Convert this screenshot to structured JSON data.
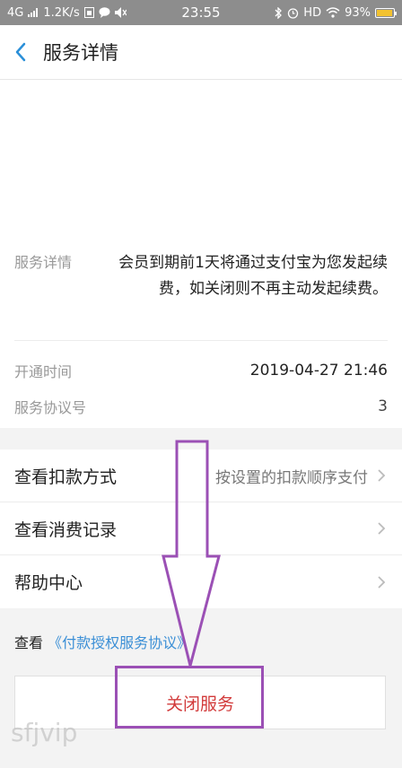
{
  "status_bar": {
    "network": "4G",
    "speed": "1.2K/s",
    "time": "23:55",
    "hd": "HD",
    "battery": "93%"
  },
  "header": {
    "title": "服务详情"
  },
  "details": {
    "service_detail_label": "服务详情",
    "service_detail_text": "会员到期前1天将通过支付宝为您发起续费，如关闭则不再主动发起续费。",
    "open_time_label": "开通时间",
    "open_time_value": "2019-04-27 21:46",
    "agreement_no_label": "服务协议号",
    "agreement_no_value": "3"
  },
  "menu": {
    "items": [
      {
        "label": "查看扣款方式",
        "value": "按设置的扣款顺序支付"
      },
      {
        "label": "查看消费记录",
        "value": ""
      },
      {
        "label": "帮助中心",
        "value": ""
      }
    ]
  },
  "agreement_link": {
    "prefix": "查看",
    "link": "《付款授权服务协议》"
  },
  "close_button": {
    "label": "关闭服务"
  },
  "watermark": "sfjvip",
  "colors": {
    "accent": "#3b8fd6",
    "danger": "#d23a3a",
    "annotation": "#9b50b5"
  }
}
